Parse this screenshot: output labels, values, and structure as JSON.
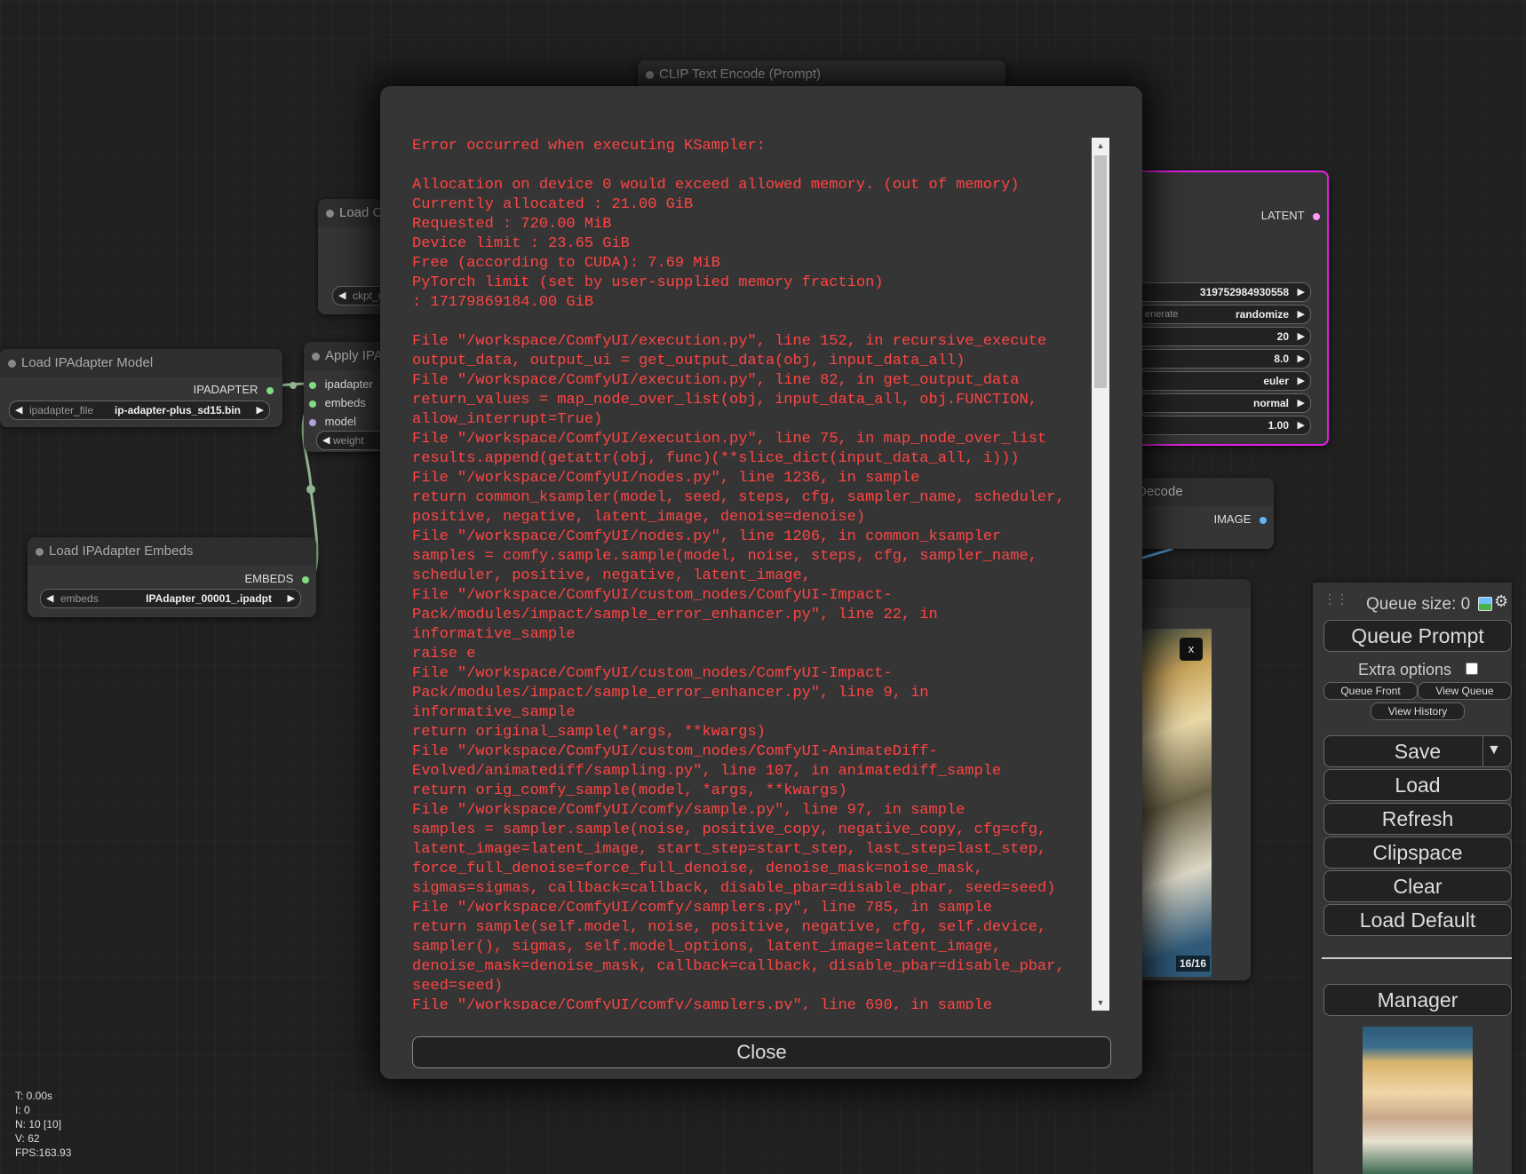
{
  "nodes": {
    "clip_text_encode": {
      "title": "CLIP Text Encode (Prompt)"
    },
    "load_checkpoint": {
      "title": "Load C",
      "widget_label": "ckpt_n"
    },
    "load_ipadapter_model": {
      "title": "Load IPAdapter Model",
      "output": "IPADAPTER",
      "widget_label": "ipadapter_file",
      "widget_value": "ip-adapter-plus_sd15.bin"
    },
    "apply_ipadapter": {
      "title": "Apply IPA",
      "inputs": [
        "ipadapter",
        "embeds",
        "model"
      ],
      "widget_label": "weight"
    },
    "load_ipadapter_embeds": {
      "title": "Load IPAdapter Embeds",
      "output": "EMBEDS",
      "widget_label": "embeds",
      "widget_value": "IPAdapter_00001_.ipadpt"
    },
    "ksampler": {
      "output": "LATENT",
      "widgets": [
        {
          "label": "",
          "value": "319752984930558"
        },
        {
          "label": "enerate",
          "value": "randomize"
        },
        {
          "label": "",
          "value": "20"
        },
        {
          "label": "",
          "value": "8.0"
        },
        {
          "label": "",
          "value": "euler"
        },
        {
          "label": "",
          "value": "normal"
        },
        {
          "label": "",
          "value": "1.00"
        }
      ]
    },
    "vae_decode": {
      "title": "Decode",
      "output": "IMAGE"
    },
    "preview": {
      "close_label": "x",
      "counter": "16/16"
    }
  },
  "error_dialog": {
    "text": "Error occurred when executing KSampler:\n\nAllocation on device 0 would exceed allowed memory. (out of memory)\nCurrently allocated : 21.00 GiB\nRequested : 720.00 MiB\nDevice limit : 23.65 GiB\nFree (according to CUDA): 7.69 MiB\nPyTorch limit (set by user-supplied memory fraction)\n: 17179869184.00 GiB\n\nFile \"/workspace/ComfyUI/execution.py\", line 152, in recursive_execute\noutput_data, output_ui = get_output_data(obj, input_data_all)\nFile \"/workspace/ComfyUI/execution.py\", line 82, in get_output_data\nreturn_values = map_node_over_list(obj, input_data_all, obj.FUNCTION, allow_interrupt=True)\nFile \"/workspace/ComfyUI/execution.py\", line 75, in map_node_over_list\nresults.append(getattr(obj, func)(**slice_dict(input_data_all, i)))\nFile \"/workspace/ComfyUI/nodes.py\", line 1236, in sample\nreturn common_ksampler(model, seed, steps, cfg, sampler_name, scheduler, positive, negative, latent_image, denoise=denoise)\nFile \"/workspace/ComfyUI/nodes.py\", line 1206, in common_ksampler\nsamples = comfy.sample.sample(model, noise, steps, cfg, sampler_name, scheduler, positive, negative, latent_image,\nFile \"/workspace/ComfyUI/custom_nodes/ComfyUI-Impact-Pack/modules/impact/sample_error_enhancer.py\", line 22, in informative_sample\nraise e\nFile \"/workspace/ComfyUI/custom_nodes/ComfyUI-Impact-Pack/modules/impact/sample_error_enhancer.py\", line 9, in informative_sample\nreturn original_sample(*args, **kwargs)\nFile \"/workspace/ComfyUI/custom_nodes/ComfyUI-AnimateDiff-Evolved/animatediff/sampling.py\", line 107, in animatediff_sample\nreturn orig_comfy_sample(model, *args, **kwargs)\nFile \"/workspace/ComfyUI/comfy/sample.py\", line 97, in sample\nsamples = sampler.sample(noise, positive_copy, negative_copy, cfg=cfg, latent_image=latent_image, start_step=start_step, last_step=last_step, force_full_denoise=force_full_denoise, denoise_mask=noise_mask, sigmas=sigmas, callback=callback, disable_pbar=disable_pbar, seed=seed)\nFile \"/workspace/ComfyUI/comfy/samplers.py\", line 785, in sample\nreturn sample(self.model, noise, positive, negative, cfg, self.device, sampler(), sigmas, self.model_options, latent_image=latent_image, denoise_mask=denoise_mask, callback=callback, disable_pbar=disable_pbar, seed=seed)\nFile \"/workspace/ComfyUI/comfy/samplers.py\", line 690, in sample",
    "close_label": "Close"
  },
  "menu": {
    "queue_size": "Queue size: 0",
    "queue_prompt": "Queue Prompt",
    "extra_options": "Extra options",
    "queue_front": "Queue Front",
    "view_queue": "View Queue",
    "view_history": "View History",
    "save": "Save",
    "load": "Load",
    "refresh": "Refresh",
    "clipspace": "Clipspace",
    "clear": "Clear",
    "load_default": "Load Default",
    "manager": "Manager"
  },
  "stats": {
    "t": "T: 0.00s",
    "i": "I: 0",
    "n": "N: 10 [10]",
    "v": "V: 62",
    "fps": "FPS:163.93"
  },
  "colors": {
    "error_text": "#ff4444",
    "ksampler_border": "#e020e0",
    "slot_green": "#7fdc7f",
    "slot_latent": "#ff9cf9",
    "slot_model": "#b39ddb",
    "image_slot": "#64b5f6"
  }
}
